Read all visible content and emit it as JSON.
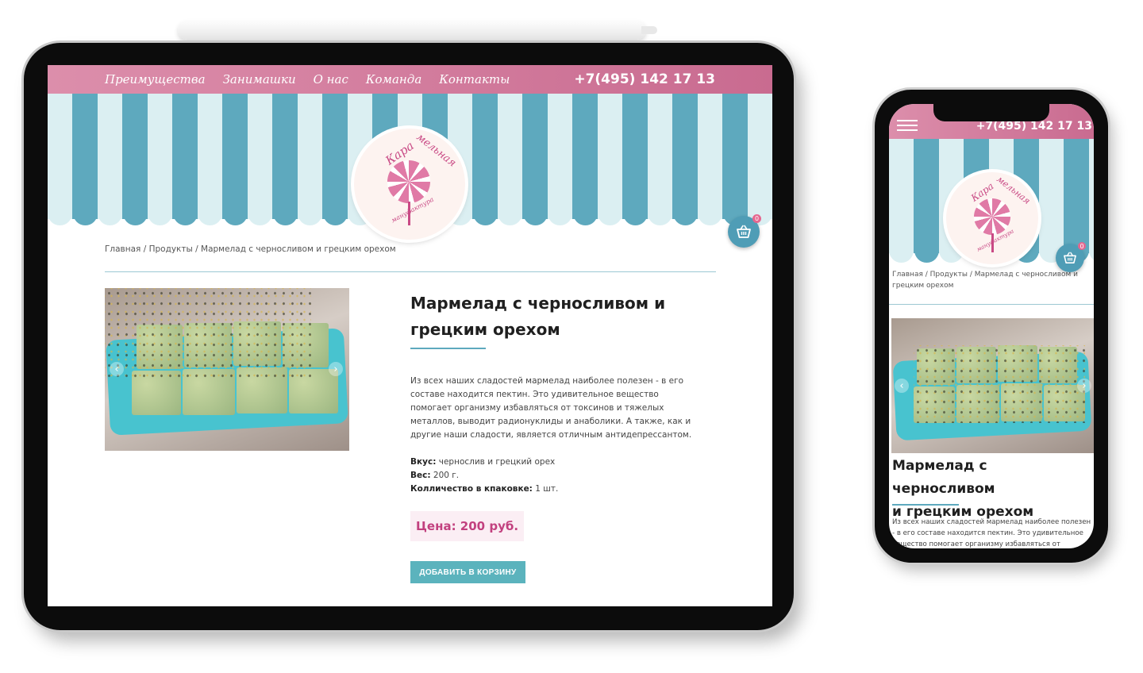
{
  "site": {
    "nav": [
      "Преимущества",
      "Занимашки",
      "О нас",
      "Команда",
      "Контакты"
    ],
    "phone": "+7(495) 142 17 13",
    "cart_count": "0",
    "logo_text_top": "Кара",
    "logo_text_arc": "мельная",
    "logo_text_bottom": "мануфактура"
  },
  "breadcrumb": {
    "home": "Главная",
    "sep": " / ",
    "products": "Продукты",
    "current": "Мармелад с черносливом и грецким орехом"
  },
  "product": {
    "title_line1": "Мармелад с черносливом и",
    "title_line2": "грецким орехом",
    "mobile_title_line1": "Мармелад с черносливом",
    "mobile_title_line2": "и грецким орехом",
    "description": "Из всех наших сладостей мармелад наиболее полезен - в его составе находится пектин. Это удивительное вещество помогает организму избавляться от токсинов и тяжелых металлов, выводит радионуклиды и анаболики. А также, как и другие наши сладости, является отличным антидепрессантом.",
    "mobile_description": "Из всех наших сладостей мармелад наиболее полезен - в его составе находится пектин. Это удивительное вещество помогает организму избавляться от токсинов и тяжёлых",
    "taste_label": "Вкус:",
    "taste_value": " чернослив и грецкий орех",
    "weight_label": "Вес:",
    "weight_value": " 200 г.",
    "qty_label": "Колличество в кпаковке:",
    "qty_value": " 1 шт.",
    "price": "Цена: 200 руб.",
    "add_to_cart": "ДОБАВИТЬ В КОРЗИНУ",
    "prev_arrow": "‹",
    "next_arrow": "›"
  },
  "colors": {
    "header_pink": "#d07c9e",
    "awning_teal": "#5ea9be",
    "awning_light": "#dbeff2",
    "price_pink": "#c2417f",
    "button_teal": "#5bb3bd"
  },
  "icons": [
    "cart-icon",
    "hamburger-icon",
    "chevron-left-icon",
    "chevron-right-icon"
  ]
}
